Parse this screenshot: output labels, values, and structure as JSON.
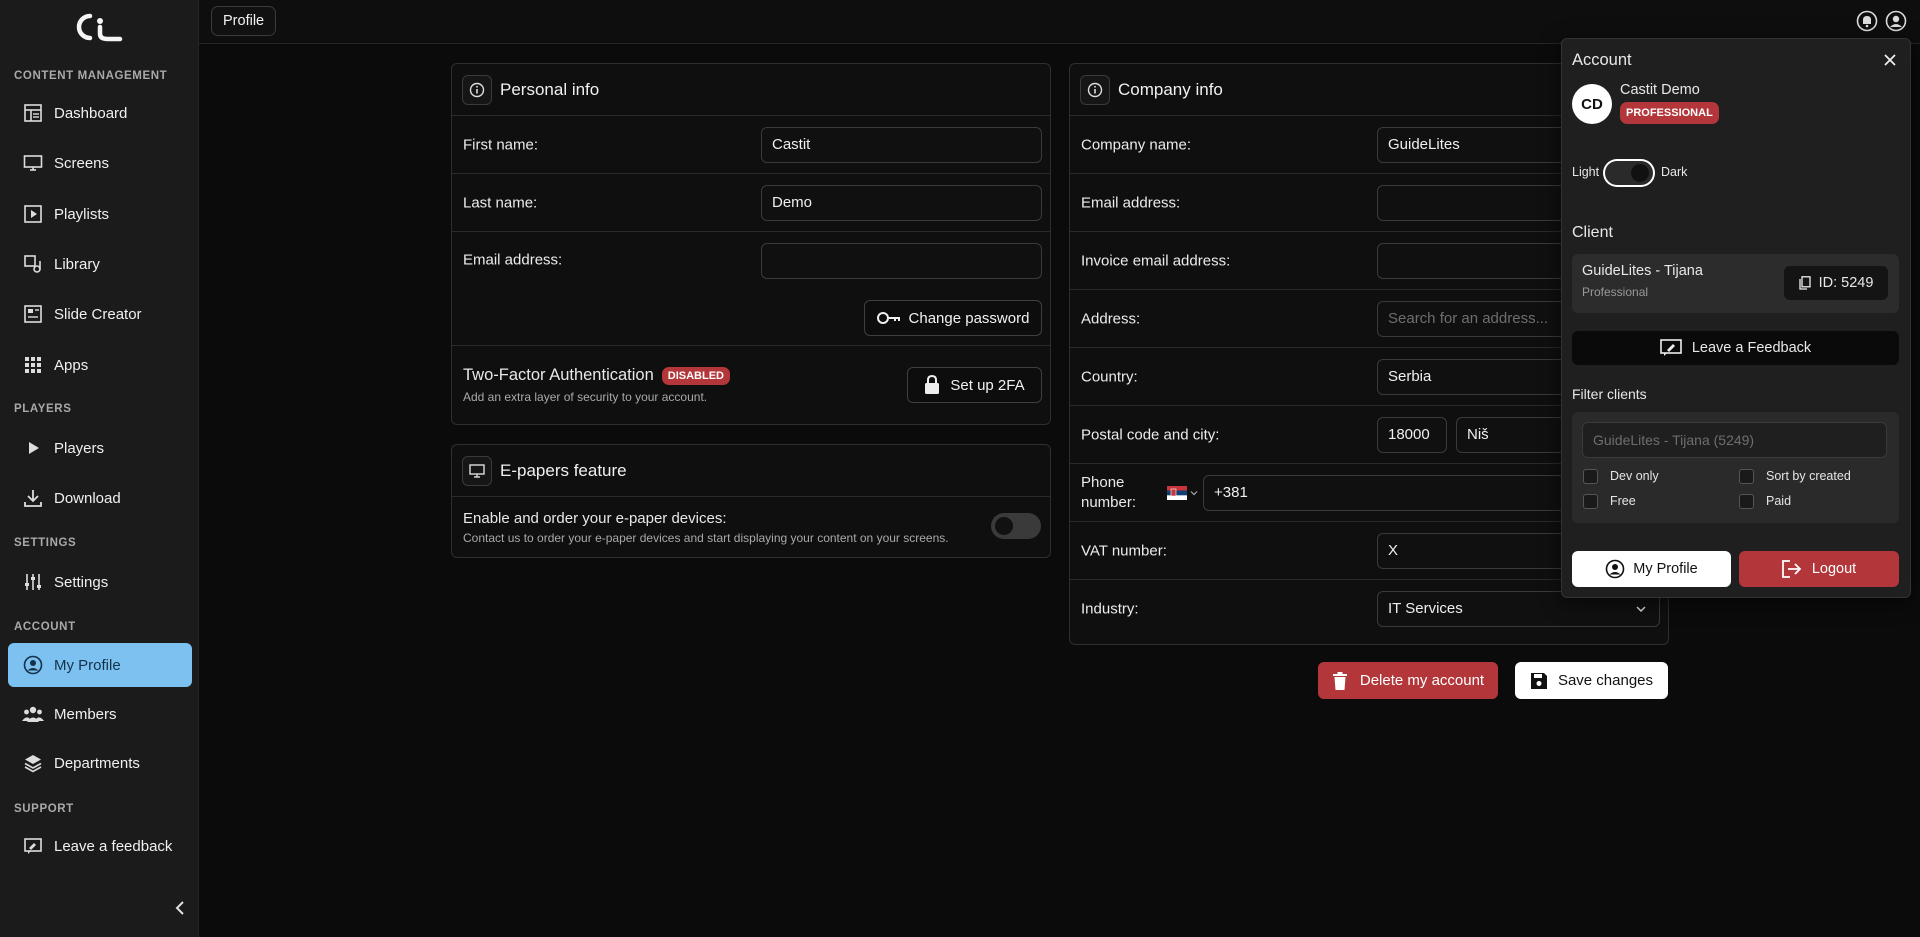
{
  "sidebar": {
    "sections": {
      "content": "CONTENT MANAGEMENT",
      "players": "PLAYERS",
      "settings": "SETTINGS",
      "account": "ACCOUNT",
      "support": "SUPPORT"
    },
    "items": {
      "dashboard": "Dashboard",
      "screens": "Screens",
      "playlists": "Playlists",
      "library": "Library",
      "slide_creator": "Slide Creator",
      "apps": "Apps",
      "players": "Players",
      "download": "Download",
      "settings": "Settings",
      "my_profile": "My Profile",
      "members": "Members",
      "departments": "Departments",
      "leave_feedback": "Leave a feedback"
    }
  },
  "header": {
    "breadcrumb": "Profile"
  },
  "personal": {
    "title": "Personal info",
    "first_name_label": "First name:",
    "first_name": "Castit",
    "last_name_label": "Last name:",
    "last_name": "Demo",
    "email_label": "Email address:",
    "email": "",
    "change_password": "Change password",
    "twofa_title": "Two-Factor Authentication",
    "twofa_status": "DISABLED",
    "twofa_desc": "Add an extra layer of security to your account.",
    "twofa_button": "Set up 2FA"
  },
  "epaper": {
    "title": "E-papers feature",
    "enable_label": "Enable and order your e-paper devices:",
    "enable_desc": "Contact us to order your e-paper devices and start displaying your content on your screens."
  },
  "company": {
    "title": "Company info",
    "name_label": "Company name:",
    "name": "GuideLites",
    "email_label": "Email address:",
    "invoice_label": "Invoice email address:",
    "address_label": "Address:",
    "address_placeholder": "Search for an address...",
    "country_label": "Country:",
    "country": "Serbia",
    "postal_label": "Postal code and city:",
    "postal": "18000",
    "city": "Niš",
    "phone_label_1": "Phone",
    "phone_label_2": "number:",
    "phone_prefix": "+381",
    "vat_label": "VAT number:",
    "vat": "X",
    "industry_label": "Industry:",
    "industry": "IT Services"
  },
  "actions": {
    "delete": "Delete my account",
    "save": "Save changes"
  },
  "account_panel": {
    "title": "Account",
    "initials": "CD",
    "user_name": "Castit Demo",
    "plan": "PROFESSIONAL",
    "theme_light": "Light",
    "theme_dark": "Dark",
    "client_heading": "Client",
    "client_name": "GuideLites - Tijana",
    "client_plan": "Professional",
    "client_id": "ID: 5249",
    "feedback_button": "Leave a Feedback",
    "filter_heading": "Filter clients",
    "filter_placeholder": "GuideLites - Tijana (5249)",
    "dev_only": "Dev only",
    "sort_by_created": "Sort by created",
    "free": "Free",
    "paid": "Paid",
    "my_profile": "My Profile",
    "logout": "Logout"
  },
  "colors": {
    "active_nav": "#7cc1f0",
    "danger": "#b3363a",
    "background": "#0b0b0b"
  }
}
